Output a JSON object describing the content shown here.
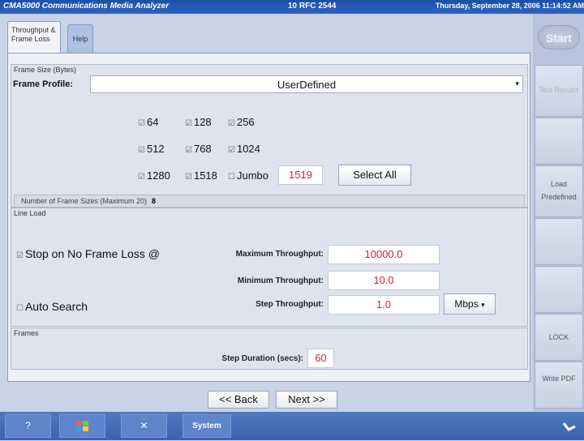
{
  "titlebar": {
    "app": "CMA5000 Communications Media Analyzer",
    "center": "10 RFC 2544",
    "datetime": "Thursday, September 28, 2006 11:14:52 AM"
  },
  "tabs": {
    "throughput": "Throughput & Frame Loss",
    "help": "Help"
  },
  "frame_size": {
    "group_title": "Frame Size (Bytes)",
    "profile_label": "Frame Profile:",
    "profile_value": "UserDefined",
    "sizes": [
      {
        "label": "64",
        "checked": true
      },
      {
        "label": "128",
        "checked": true
      },
      {
        "label": "256",
        "checked": true
      },
      {
        "label": "512",
        "checked": true
      },
      {
        "label": "768",
        "checked": true
      },
      {
        "label": "1024",
        "checked": true
      },
      {
        "label": "1280",
        "checked": true
      },
      {
        "label": "1518",
        "checked": true
      },
      {
        "label": "Jumbo",
        "checked": false
      }
    ],
    "jumbo_value": "1519",
    "select_all": "Select All",
    "count_label": "Number of Frame Sizes (Maximum 20)",
    "count_value": "8"
  },
  "line_load": {
    "group_title": "Line Load",
    "stop_label": "Stop on No Frame Loss @",
    "auto_label": "Auto Search",
    "max_label": "Maximum Throughput:",
    "max_value": "10000.0",
    "min_label": "Minimum Throughput:",
    "min_value": "10.0",
    "step_label": "Step Throughput:",
    "step_value": "1.0",
    "unit": "Mbps"
  },
  "frames": {
    "group_title": "Frames",
    "duration_label": "Step Duration (secs):",
    "duration_value": "60"
  },
  "nav": {
    "back": "<< Back",
    "next": "Next >>"
  },
  "sidebar": {
    "start": "Start",
    "test_results": "Test Results",
    "load_predefined": "Load Predefined",
    "lock": "LOCK",
    "write_pdf": "Write PDF"
  },
  "taskbar": {
    "system": "System"
  },
  "icons": {
    "checkbox_checked": "☑",
    "checkbox_unchecked": "☐",
    "dropdown": "▾",
    "help_cursor": "?",
    "close": "✕"
  }
}
